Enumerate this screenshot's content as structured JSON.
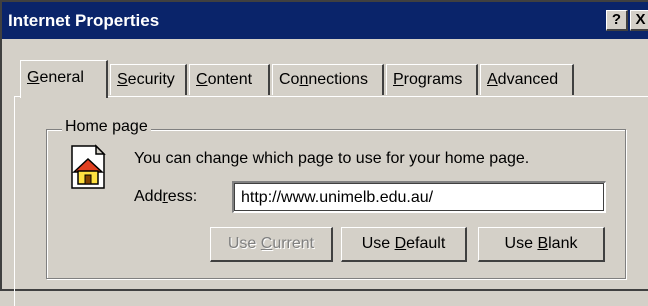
{
  "window": {
    "title": "Internet Properties",
    "help_btn": "?",
    "close_btn": "X"
  },
  "tabs": [
    {
      "label_pre": "",
      "label_key": "G",
      "label_post": "eneral"
    },
    {
      "label_pre": "",
      "label_key": "S",
      "label_post": "ecurity"
    },
    {
      "label_pre": "",
      "label_key": "C",
      "label_post": "ontent"
    },
    {
      "label_pre": "Co",
      "label_key": "n",
      "label_post": "nections"
    },
    {
      "label_pre": "",
      "label_key": "P",
      "label_post": "rograms"
    },
    {
      "label_pre": "",
      "label_key": "A",
      "label_post": "dvanced"
    }
  ],
  "home_page": {
    "group_label": "Home page",
    "description": "You can change which page to use for your home page.",
    "address_pre": "Add",
    "address_key": "r",
    "address_post": "ess:",
    "address_value": "http://www.unimelb.edu.au/",
    "icon": "home-page-icon",
    "buttons": {
      "current_pre": "Use ",
      "current_key": "C",
      "current_post": "urrent",
      "default_pre": "Use ",
      "default_key": "D",
      "default_post": "efault",
      "blank_pre": "Use ",
      "blank_key": "B",
      "blank_post": "lank"
    }
  },
  "colors": {
    "titlebar": "#0a246a",
    "face": "#d4d0c8"
  }
}
